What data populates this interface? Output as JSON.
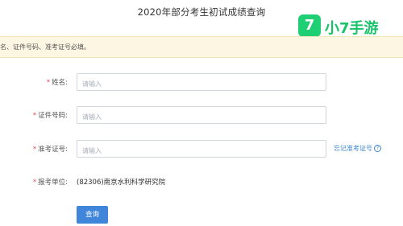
{
  "page_title": "2020年部分考生初试成绩查询",
  "watermark": {
    "logo_glyph": "7",
    "text": "小7手游",
    "color": "#1fcf74"
  },
  "notice": "名、证件号码、准考证号必填。",
  "form": {
    "name": {
      "label": "姓名:",
      "placeholder": "请输入"
    },
    "id_number": {
      "label": "证件号码:",
      "placeholder": "请输入"
    },
    "exam_number": {
      "label": "准考证号:",
      "placeholder": "请输入",
      "forgot_link": "忘记准考证号",
      "help_icon": "?"
    },
    "exam_unit": {
      "label": "报考单位:",
      "value": "(82306)南京水利科学研究院"
    },
    "required_mark": "*"
  },
  "submit_label": "查询",
  "colors": {
    "accent": "#3f86db",
    "required": "#e24b4b",
    "notice_bg": "#fdf6e3",
    "link": "#3a85d6"
  }
}
